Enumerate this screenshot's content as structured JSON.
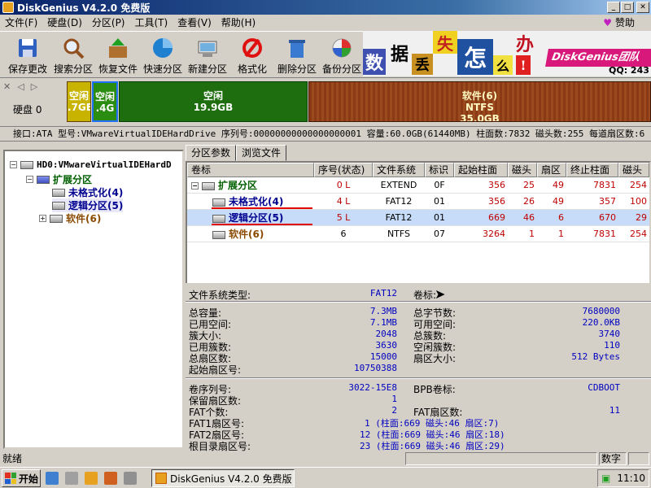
{
  "window": {
    "title": "DiskGenius V4.2.0 免费版"
  },
  "menu": {
    "items": [
      "文件(F)",
      "硬盘(D)",
      "分区(P)",
      "工具(T)",
      "查看(V)",
      "帮助(H)"
    ],
    "donate": "赞助"
  },
  "toolbar": {
    "buttons": [
      {
        "label": "保存更改",
        "icon": "save-icon"
      },
      {
        "label": "搜索分区",
        "icon": "magnifier-icon"
      },
      {
        "label": "恢复文件",
        "icon": "recover-files-icon"
      },
      {
        "label": "快速分区",
        "icon": "quick-partition-icon"
      },
      {
        "label": "新建分区",
        "icon": "new-partition-icon"
      },
      {
        "label": "格式化",
        "icon": "format-icon"
      },
      {
        "label": "删除分区",
        "icon": "recycle-bin-icon"
      },
      {
        "label": "备份分区",
        "icon": "backup-icon"
      }
    ]
  },
  "banner": {
    "chars": [
      "数",
      "据",
      "丢",
      "失",
      "怎",
      "么",
      "办",
      "!"
    ],
    "brand": "DiskGenius团队",
    "qq": "QQ: 243"
  },
  "disk": {
    "label": "硬盘 0",
    "partitions": [
      {
        "name": "空闲",
        "size": ".7GB",
        "color": "#c8b400"
      },
      {
        "name": "空闲",
        "size": ".4G",
        "color": "#2a8c10"
      },
      {
        "name": "空闲",
        "size": "19.9GB",
        "color": "#1e6e10"
      },
      {
        "name": "软件(6)",
        "fs": "NTFS",
        "size": "35.0GB",
        "color": "#8a3a14"
      }
    ]
  },
  "infobar": {
    "text": "接口:ATA  型号:VMwareVirtualIDEHardDrive  序列号:00000000000000000001  容量:60.0GB(61440MB)  柱面数:7832  磁头数:255  每道扇区数:6"
  },
  "tree": {
    "root": "HD0:VMwareVirtualIDEHardD",
    "extended": "扩展分区",
    "children": [
      "未格式化(4)",
      "逻辑分区(5)"
    ],
    "software": "软件(6)"
  },
  "tabs": {
    "params": "分区参数",
    "browse": "浏览文件"
  },
  "table": {
    "headers": [
      "卷标",
      "序号(状态)",
      "文件系统",
      "标识",
      "起始柱面",
      "磁头",
      "扇区",
      "终止柱面",
      "磁头"
    ],
    "rows": [
      {
        "name": "扩展分区",
        "seq": "0 L",
        "fs": "EXTEND",
        "id": "0F",
        "start": "356",
        "head": "25",
        "sector": "49",
        "end": "7831",
        "ehead": "254"
      },
      {
        "name": "未格式化(4)",
        "seq": "4 L",
        "fs": "FAT12",
        "id": "01",
        "start": "356",
        "head": "26",
        "sector": "49",
        "end": "357",
        "ehead": "100"
      },
      {
        "name": "逻辑分区(5)",
        "seq": "5 L",
        "fs": "FAT12",
        "id": "01",
        "start": "669",
        "head": "46",
        "sector": "6",
        "end": "670",
        "ehead": "29"
      },
      {
        "name": "软件(6)",
        "seq": "6",
        "fs": "NTFS",
        "id": "07",
        "start": "3264",
        "head": "1",
        "sector": "1",
        "end": "7831",
        "ehead": "254"
      }
    ]
  },
  "details": {
    "fs_type_label": "文件系统类型:",
    "fs_type": "FAT12",
    "vol_label": "卷标:",
    "left": [
      {
        "k": "总容量:",
        "v": "7.3MB"
      },
      {
        "k": "已用空间:",
        "v": "7.1MB"
      },
      {
        "k": "簇大小:",
        "v": "2048"
      },
      {
        "k": "已用簇数:",
        "v": "3630"
      },
      {
        "k": "总扇区数:",
        "v": "15000"
      },
      {
        "k": "起始扇区号:",
        "v": "10750388"
      }
    ],
    "right": [
      {
        "k": "总字节数:",
        "v": "7680000"
      },
      {
        "k": "可用空间:",
        "v": "220.0KB"
      },
      {
        "k": "总簇数:",
        "v": "3740"
      },
      {
        "k": "空闲簇数:",
        "v": "110"
      },
      {
        "k": "扇区大小:",
        "v": "512 Bytes"
      }
    ],
    "serial_k": "卷序列号:",
    "serial_v": "3022-15E8",
    "bpb_k": "BPB卷标:",
    "bpb_v": "CDBOOT",
    "reserved_k": "保留扇区数:",
    "reserved_v": "1",
    "fat_count_k": "FAT个数:",
    "fat_count_v": "2",
    "fat_sectors_k": "FAT扇区数:",
    "fat_sectors_v": "11",
    "fat1_k": "FAT1扇区号:",
    "fat1_v": "1 (柱面:669 磁头:46 扇区:7)",
    "fat2_k": "FAT2扇区号:",
    "fat2_v": "12 (柱面:669 磁头:46 扇区:18)",
    "root_k": "根目录扇区号:",
    "root_v": "23 (柱面:669 磁头:46 扇区:29)"
  },
  "status": {
    "text": "就绪",
    "num": "数字"
  },
  "taskbar": {
    "start": "开始",
    "task": "DiskGenius V4.2.0 免费版",
    "time": "11:10"
  }
}
